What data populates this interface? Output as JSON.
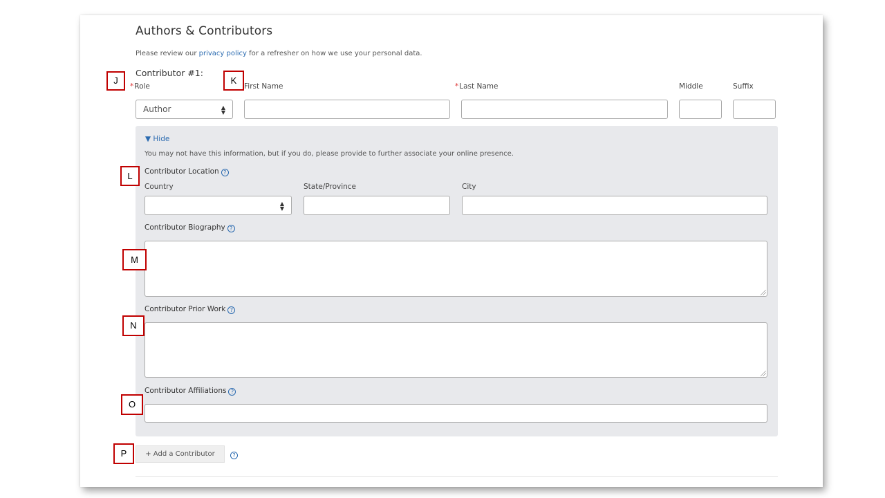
{
  "section": {
    "title": "Authors & Contributors",
    "intro_before": "Please review our ",
    "intro_link": "privacy policy",
    "intro_after": " for a refresher on how we use your personal data."
  },
  "contributor": {
    "heading": "Contributor #1:",
    "required_mark": "*",
    "role_label": "Role",
    "role_value": "Author",
    "first_name_label": "First Name",
    "last_name_label": "Last Name",
    "middle_label": "Middle",
    "suffix_label": "Suffix",
    "first_name_value": "",
    "last_name_value": "",
    "middle_value": "",
    "suffix_value": ""
  },
  "details": {
    "toggle_label": "▼ Hide",
    "hint": "You may not have this information, but if you do, please provide to further associate your online presence.",
    "location_label": "Contributor Location",
    "country_label": "Country",
    "country_value": "",
    "state_label": "State/Province",
    "city_label": "City",
    "biography_label": "Contributor Biography",
    "prior_work_label": "Contributor Prior Work",
    "affiliations_label": "Contributor Affiliations",
    "help_glyph": "?"
  },
  "actions": {
    "add_contributor_label": "+ Add a Contributor"
  },
  "callouts": [
    "J",
    "K",
    "L",
    "M",
    "N",
    "O",
    "P"
  ],
  "colors": {
    "link": "#2a6ab0",
    "required": "#dd3333",
    "panel_bg": "#e8e9ec",
    "callout_border": "#c00000"
  }
}
